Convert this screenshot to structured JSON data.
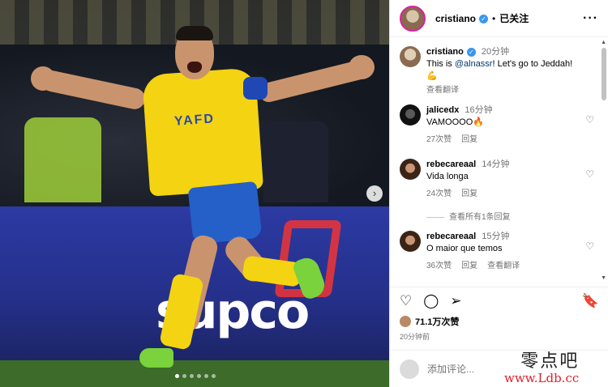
{
  "post": {
    "image_label": "supco",
    "shirt_text": "YAFD",
    "carousel_count": 6,
    "carousel_active": 1
  },
  "header": {
    "username": "cristiano",
    "separator": "•",
    "follow_status": "已关注",
    "more": "···"
  },
  "comments": [
    {
      "user": "cristiano",
      "time": "20分钟",
      "text_pre": "This is ",
      "mention": "@alnassr",
      "text_post": "! Let's go to Jeddah!",
      "emoji": "💪",
      "translate": "查看翻译"
    },
    {
      "user": "jalicedx",
      "time": "16分钟",
      "text": "VAMOOOO🔥",
      "likes": "27次赞",
      "reply": "回复"
    },
    {
      "user": "rebecareaal",
      "time": "14分钟",
      "text": "Vida longa",
      "likes": "24次赞",
      "reply": "回复",
      "view_replies": "查看所有1条回复"
    },
    {
      "user": "rebecareaal",
      "time": "15分钟",
      "text": "O maior que temos",
      "likes": "36次赞",
      "reply": "回复",
      "translate": "查看翻译"
    }
  ],
  "stats": {
    "likes": "71.1万次赞",
    "posted": "20分钟前"
  },
  "composer": {
    "placeholder": "添加评论..."
  },
  "watermark": {
    "cn": "零点吧",
    "url": "www.Ldb.cc"
  },
  "colors": {
    "verified": "#3897f0",
    "mention": "#00376b",
    "jersey": "#f4d312",
    "shorts": "#2560c9",
    "board": "#2c3aa3"
  },
  "icons": [
    "next-arrow-icon",
    "heart-icon",
    "comment-icon",
    "share-icon",
    "bookmark-icon",
    "more-icon",
    "verified-icon"
  ]
}
